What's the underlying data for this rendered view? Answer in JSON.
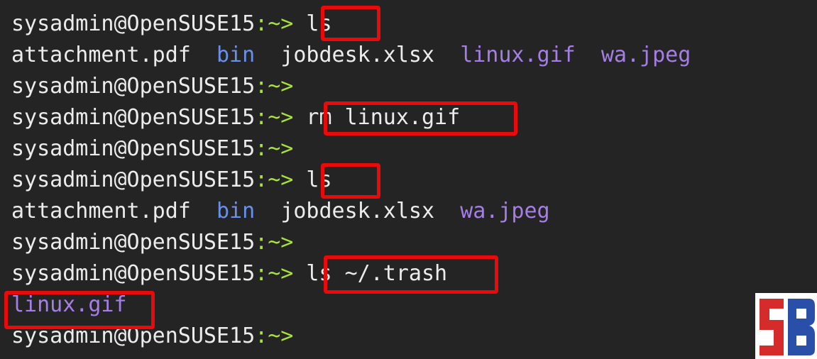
{
  "terminal": {
    "lines": [
      {
        "user_host": "sysadmin@OpenSUSE15",
        "path": ":~>",
        "command": "ls"
      },
      {
        "files": [
          "attachment.pdf",
          "bin",
          "jobdesk.xlsx",
          "linux.gif",
          "wa.jpeg"
        ]
      },
      {
        "user_host": "sysadmin@OpenSUSE15",
        "path": ":~>"
      },
      {
        "user_host": "sysadmin@OpenSUSE15",
        "path": ":~>",
        "command": "rm linux.gif"
      },
      {
        "user_host": "sysadmin@OpenSUSE15",
        "path": ":~>"
      },
      {
        "user_host": "sysadmin@OpenSUSE15",
        "path": ":~>",
        "command": "ls"
      },
      {
        "files": [
          "attachment.pdf",
          "bin",
          "jobdesk.xlsx",
          "wa.jpeg"
        ]
      },
      {
        "user_host": "sysadmin@OpenSUSE15",
        "path": ":~>"
      },
      {
        "user_host": "sysadmin@OpenSUSE15",
        "path": ":~>",
        "command": "ls ~/.trash"
      },
      {
        "files": [
          "linux.gif"
        ]
      },
      {
        "user_host": "sysadmin@OpenSUSE15",
        "path": ":~>"
      }
    ]
  },
  "colors": {
    "background": "#242424",
    "text": "#ececec",
    "prompt_path": "#a8e23b",
    "directory": "#6a90e8",
    "media_file": "#a57ee6",
    "highlight_box": "#ea0a0a"
  },
  "logo": {
    "icon": "sb-logo-icon"
  }
}
